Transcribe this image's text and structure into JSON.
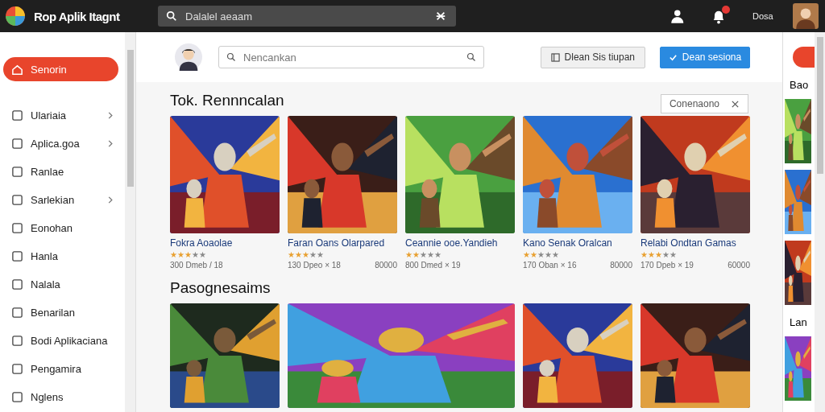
{
  "app": {
    "title": "Rop Aplik Itagnt",
    "search_value": "Dalalel aeaam",
    "user_name": "Dosa",
    "notification": true
  },
  "header": {
    "search_placeholder": "Nencankan",
    "buttons": [
      {
        "label": "Dlean Sis tiupan",
        "kind": "secondary"
      },
      {
        "label": "Dean sesiona",
        "kind": "primary"
      }
    ]
  },
  "sidebar": {
    "items": [
      {
        "label": "Senorin",
        "selected": true,
        "submenu": false
      },
      {
        "label": "Ulariaia",
        "selected": false,
        "submenu": true
      },
      {
        "label": "Aplica.goa",
        "selected": false,
        "submenu": true
      },
      {
        "label": "Ranlae",
        "selected": false,
        "submenu": false
      },
      {
        "label": "Sarlekian",
        "selected": false,
        "submenu": true
      },
      {
        "label": "Eonohan",
        "selected": false,
        "submenu": false
      },
      {
        "label": "Hanla",
        "selected": false,
        "submenu": false
      },
      {
        "label": "Nalala",
        "selected": false,
        "submenu": false
      },
      {
        "label": "Benarilan",
        "selected": false,
        "submenu": false
      },
      {
        "label": "Bodi Aplikaciana",
        "selected": false,
        "submenu": false
      },
      {
        "label": "Pengamira",
        "selected": false,
        "submenu": false
      },
      {
        "label": "Nglens",
        "selected": false,
        "submenu": false
      }
    ]
  },
  "sections": [
    {
      "title": "Tok. Rennncalan",
      "sort": "Conenaono",
      "games": [
        {
          "title": "Fokra Aoaolae",
          "stars": 3,
          "meta": "300 Dmeb / 18"
        },
        {
          "title": "Faran Oans Olarpared",
          "stars": 3,
          "meta": "130 Dpeo × 18",
          "price": "80000"
        },
        {
          "title": "Ceannie ooe.Yandieh",
          "stars": 2,
          "meta": "800 Dmed × 19"
        },
        {
          "title": "Kano Senak Oralcan",
          "stars": 2,
          "meta": "170 Oban × 16",
          "price": "80000"
        },
        {
          "title": "Relabi Ondtan Gamas",
          "stars": 3,
          "meta": "170 Dpeb × 19",
          "price": "60000"
        }
      ]
    },
    {
      "title": "Pasognesaims",
      "games": [
        {
          "wide": false
        },
        {
          "wide": true
        },
        {
          "wide": false
        },
        {
          "wide": false
        }
      ]
    }
  ],
  "side_panel": {
    "headings": [
      "Bao",
      "Lan"
    ]
  }
}
